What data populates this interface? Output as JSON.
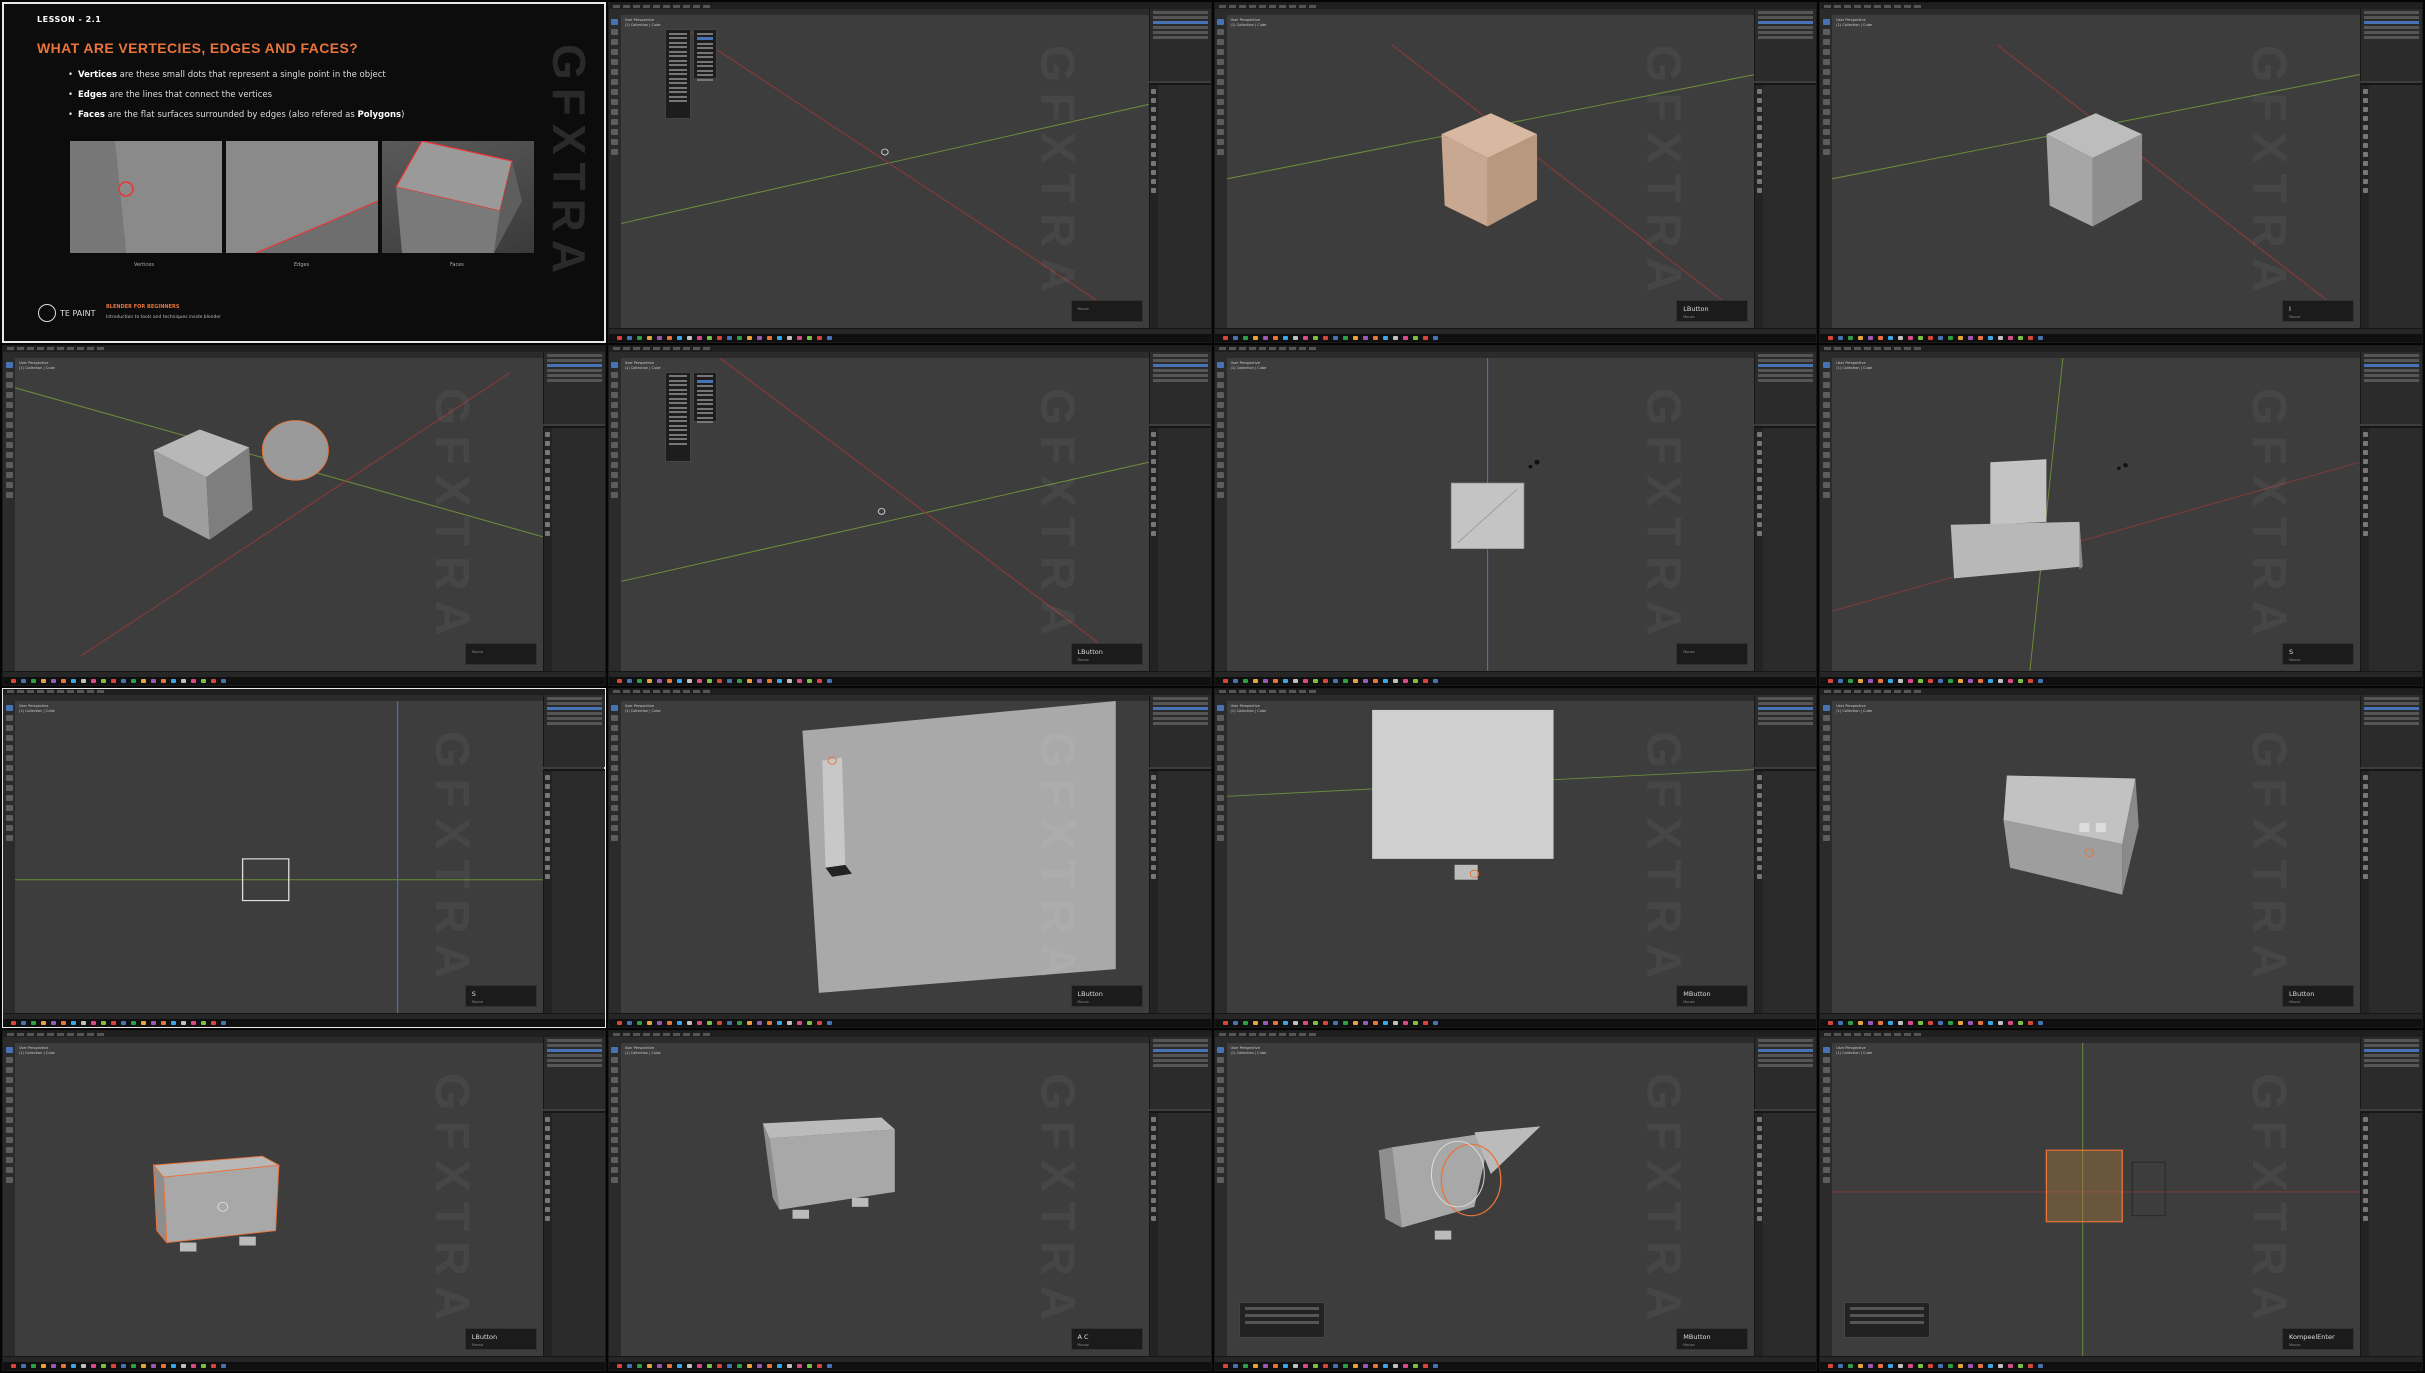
{
  "slide": {
    "lesson": "LESSON - 2.1",
    "title": "WHAT ARE VERTECIES, EDGES AND FACES?",
    "bullets": [
      {
        "term": "Vertices",
        "text": " are these small dots that represent a single point in the object"
      },
      {
        "term": "Edges",
        "text": " are the lines that connect the vertices"
      },
      {
        "term": "Faces",
        "text": " are the flat surfaces surrounded by edges (also refered as ",
        "term2": "Polygons",
        "tail": ")"
      }
    ],
    "captions": [
      "Vertices",
      "Edges",
      "Faces"
    ],
    "logo_text": "TE PAINT",
    "course_title": "BLENDER FOR BEGINNERS",
    "course_subtitle": "Introduction to tools and techniques inside blender",
    "watermark": "GFXTRA"
  },
  "viewport_info": [
    "User Perspective",
    "(1) Collection | Cube"
  ],
  "frames": [
    {
      "key": "",
      "menu": true
    },
    {
      "key": "LButton"
    },
    {
      "key": "I"
    },
    {
      "key": ""
    },
    {
      "key": "LButton",
      "menu": true
    },
    {
      "key": ""
    },
    {
      "key": "S"
    },
    {
      "key": "S"
    },
    {
      "key": "LButton"
    },
    {
      "key": "MButton"
    },
    {
      "key": "LButton"
    },
    {
      "key": "LButton"
    },
    {
      "key": "A C"
    },
    {
      "key": "MButton"
    },
    {
      "key": "KompeelEnter"
    },
    {
      "key": "MButton"
    }
  ],
  "keyhint_sub": "Mouse",
  "colors": {
    "accent": "#e8743b",
    "select": "#4772b3",
    "viewport": "#3d3d3d"
  }
}
